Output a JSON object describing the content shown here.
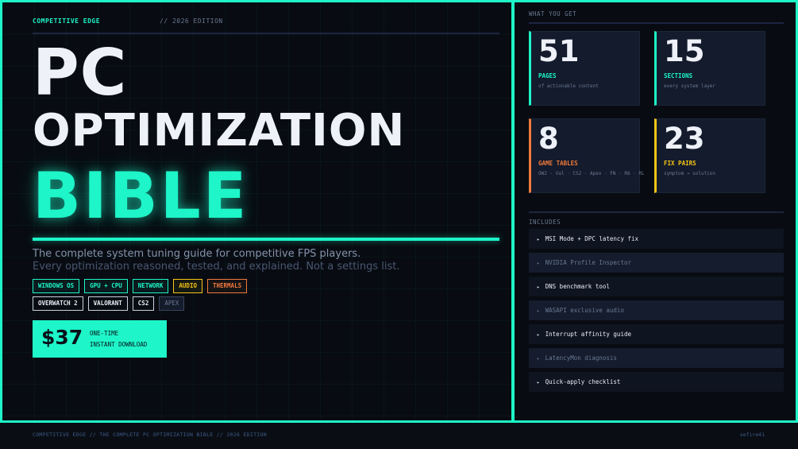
{
  "header": {
    "brand": "COMPETITIVE EDGE",
    "edition": "//  2026 EDITION"
  },
  "title": {
    "line1": "PC",
    "line2": "OPTIMIZATION",
    "line3": "BIBLE"
  },
  "subtitle": {
    "line1": "The complete system tuning guide for competitive FPS players.",
    "line2": "Every optimization reasoned, tested, and explained. Not a settings list."
  },
  "tags": {
    "row1": [
      "WINDOWS OS",
      "GPU + CPU",
      "NETWORK",
      "AUDIO",
      "THERMALS"
    ],
    "row2": [
      "OVERWATCH 2",
      "VALORANT",
      "CS2",
      "APEX"
    ]
  },
  "price": {
    "amount": "$37",
    "line1": "ONE-TIME",
    "line2": "INSTANT DOWNLOAD"
  },
  "what_you_get": {
    "heading": "WHAT YOU GET",
    "stats": [
      {
        "number": "51",
        "label": "PAGES",
        "desc": "of actionable content",
        "accent": "#1ef5c8"
      },
      {
        "number": "15",
        "label": "SECTIONS",
        "desc": "every system layer",
        "accent": "#1ef5c8"
      },
      {
        "number": "8",
        "label": "GAME TABLES",
        "desc": "OW2 · Val · CS2 · Apex · FN · R6 · RL",
        "accent": "#f07a3c"
      },
      {
        "number": "23",
        "label": "FIX PAIRS",
        "desc": "symptom → solution",
        "accent": "#f5c518"
      }
    ]
  },
  "includes": {
    "heading": "INCLUDES",
    "items": [
      "MSI Mode + DPC latency fix",
      "NVIDIA Profile Inspector",
      "DNS benchmark tool",
      "WASAPI exclusive audio",
      "Interrupt affinity guide",
      "LatencyMon diagnosis",
      "Quick-apply checklist"
    ],
    "bullet": "▸"
  },
  "footer": {
    "left": "COMPETITIVE EDGE  //  THE COMPLETE PC OPTIMIZATION BIBLE  //  2026 EDITION",
    "right": "sefire41"
  },
  "colors": {
    "accent": "#1ef5c8",
    "yellow": "#f5c518",
    "orange": "#f07a3c",
    "background": "#080c12"
  }
}
